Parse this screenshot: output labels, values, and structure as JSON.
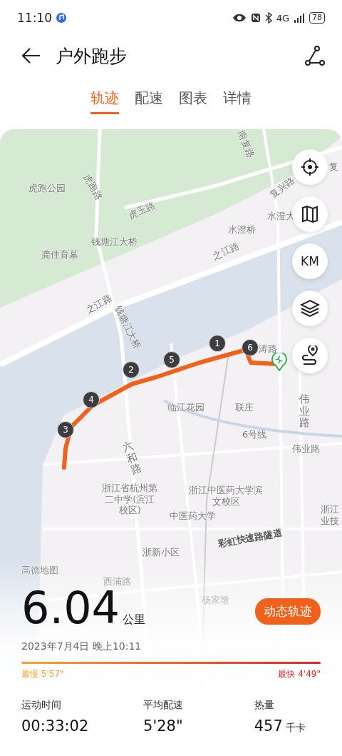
{
  "status_bar": {
    "time": "11:10",
    "battery": "78",
    "network": "4G"
  },
  "header": {
    "title": "户外跑步"
  },
  "tabs": [
    {
      "label": "轨迹",
      "selected": true
    },
    {
      "label": "配速",
      "selected": false
    },
    {
      "label": "图表",
      "selected": false
    },
    {
      "label": "详情",
      "selected": false
    }
  ],
  "map": {
    "labels": [
      "虎跑公园",
      "虎跑路",
      "虎玉路",
      "钱塘江大桥",
      "龚佳育墓",
      "南复路",
      "复兴路",
      "水澄大",
      "水澄桥",
      "之江路",
      "之江路",
      "钱塘江大桥",
      "复",
      "临江花园",
      "联庄",
      "伟业路",
      "6号线",
      "伟业路",
      "六和路",
      "浙江省杭州第二中学(滨江校区)",
      "浙江中医药大学滨文校区",
      "中医药大学",
      "浙江业技",
      "彩虹快速路隧道",
      "浙新小区",
      "高德地图",
      "西浦路",
      "杨家墩",
      "涛路"
    ],
    "km_markers": [
      "1",
      "2",
      "3",
      "4",
      "5",
      "6"
    ],
    "controls": [
      {
        "kind": "locate"
      },
      {
        "kind": "map"
      },
      {
        "kind": "unit",
        "label": "KM"
      },
      {
        "kind": "layers"
      },
      {
        "kind": "route"
      }
    ]
  },
  "summary": {
    "distance": "6.04",
    "unit": "公里",
    "date": "2023年7月4日 晚上10:11",
    "replay_button": "动态轨迹",
    "pace": {
      "slowest_label": "最慢",
      "slowest": "5'57\"",
      "fastest_label": "最快",
      "fastest": "4'49\""
    },
    "stats": [
      {
        "label": "运动时间",
        "value": "00:33:02"
      },
      {
        "label": "平均配速",
        "value": "5'28\""
      },
      {
        "label": "热量",
        "value": "457",
        "unit": "千卡"
      }
    ]
  }
}
